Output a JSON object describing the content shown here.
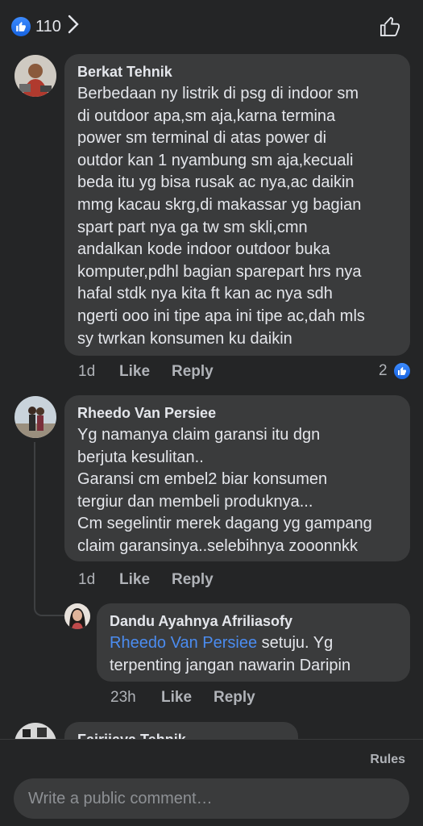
{
  "header": {
    "reaction_count": "110",
    "reaction_icon": "thumbs-up-icon",
    "like_button_icon": "thumbs-up-outline-icon"
  },
  "comments": [
    {
      "author": "Berkat Tehnik",
      "text": "Berbedaan ny listrik di psg di indoor sm\ndi outdoor apa,sm aja,karna termina\npower sm terminal di atas power di\noutdor kan 1 nyambung sm aja,kecuali\nbeda itu yg bisa rusak ac nya,ac daikin\nmmg kacau skrg,di makassar yg bagian\nspart part nya ga tw sm skli,cmn\nandalkan kode indoor outdoor buka\nkomputer,pdhl bagian sparepart hrs nya\nhafal stdk nya kita ft kan ac nya sdh\nngerti ooo ini tipe apa ini tipe ac,dah mls\nsy twrkan konsumen ku daikin",
      "time": "1d",
      "like": "Like",
      "reply": "Reply",
      "reaction_count": "2"
    },
    {
      "author": "Rheedo Van Persiee",
      "text": "Yg namanya claim garansi itu dgn\nberjuta kesulitan..\nGaransi cm embel2 biar konsumen\ntergiur dan membeli produknya...\nCm segelintir merek dagang yg gampang\nclaim garansinya..selebihnya zooonnkk",
      "time": "1d",
      "like": "Like",
      "reply": "Reply"
    },
    {
      "author": "Fairjjaya Tehnik"
    }
  ],
  "reply": {
    "author": "Dandu Ayahnya Afriliasofy",
    "mention": "Rheedo Van Persiee",
    "text_rest": " setuju. Yg\nterpenting jangan nawarin Daripin",
    "time": "23h",
    "like": "Like",
    "reply": "Reply"
  },
  "footer": {
    "rules": "Rules",
    "placeholder": "Write a public comment…"
  }
}
